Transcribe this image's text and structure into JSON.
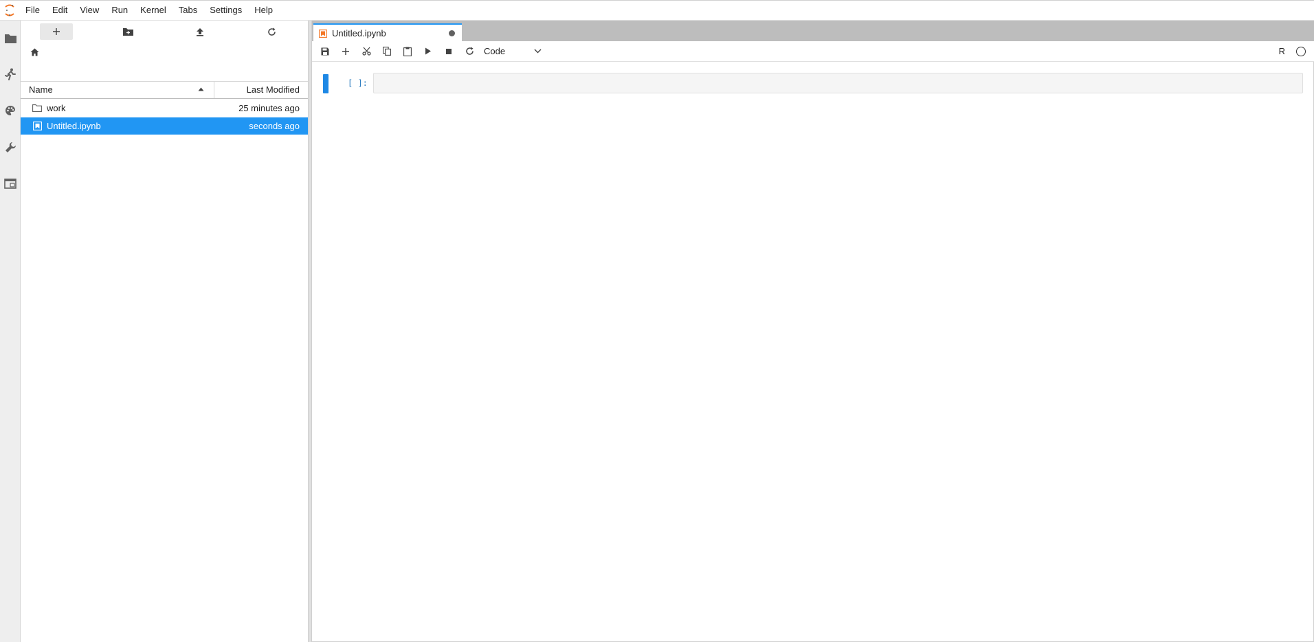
{
  "menu": [
    "File",
    "Edit",
    "View",
    "Run",
    "Kernel",
    "Tabs",
    "Settings",
    "Help"
  ],
  "activity_bar": {
    "icons": [
      "folder-icon",
      "running-icon",
      "palette-icon",
      "wrench-icon",
      "tabs-icon"
    ]
  },
  "file_browser": {
    "toolbar_icons": [
      "plus-icon",
      "new-folder-icon",
      "upload-icon",
      "refresh-icon"
    ],
    "columns": {
      "name": "Name",
      "last_modified": "Last Modified"
    },
    "rows": [
      {
        "name": "work",
        "modified": "25 minutes ago",
        "type": "folder",
        "selected": false
      },
      {
        "name": "Untitled.ipynb",
        "modified": "seconds ago",
        "type": "notebook",
        "selected": true
      }
    ]
  },
  "tab": {
    "title": "Untitled.ipynb"
  },
  "notebook_toolbar": {
    "icons": [
      "save-icon",
      "plus-icon",
      "cut-icon",
      "copy-icon",
      "paste-icon",
      "run-icon",
      "stop-icon",
      "restart-icon"
    ],
    "cell_type": "Code",
    "kernel_name": "R"
  },
  "cell": {
    "prompt": "[ ]:",
    "content": ""
  },
  "colors": {
    "accent": "#2196f3",
    "selected_row": "#2196f3",
    "cell_active": "#1e88e5",
    "logo": "#f37726"
  }
}
